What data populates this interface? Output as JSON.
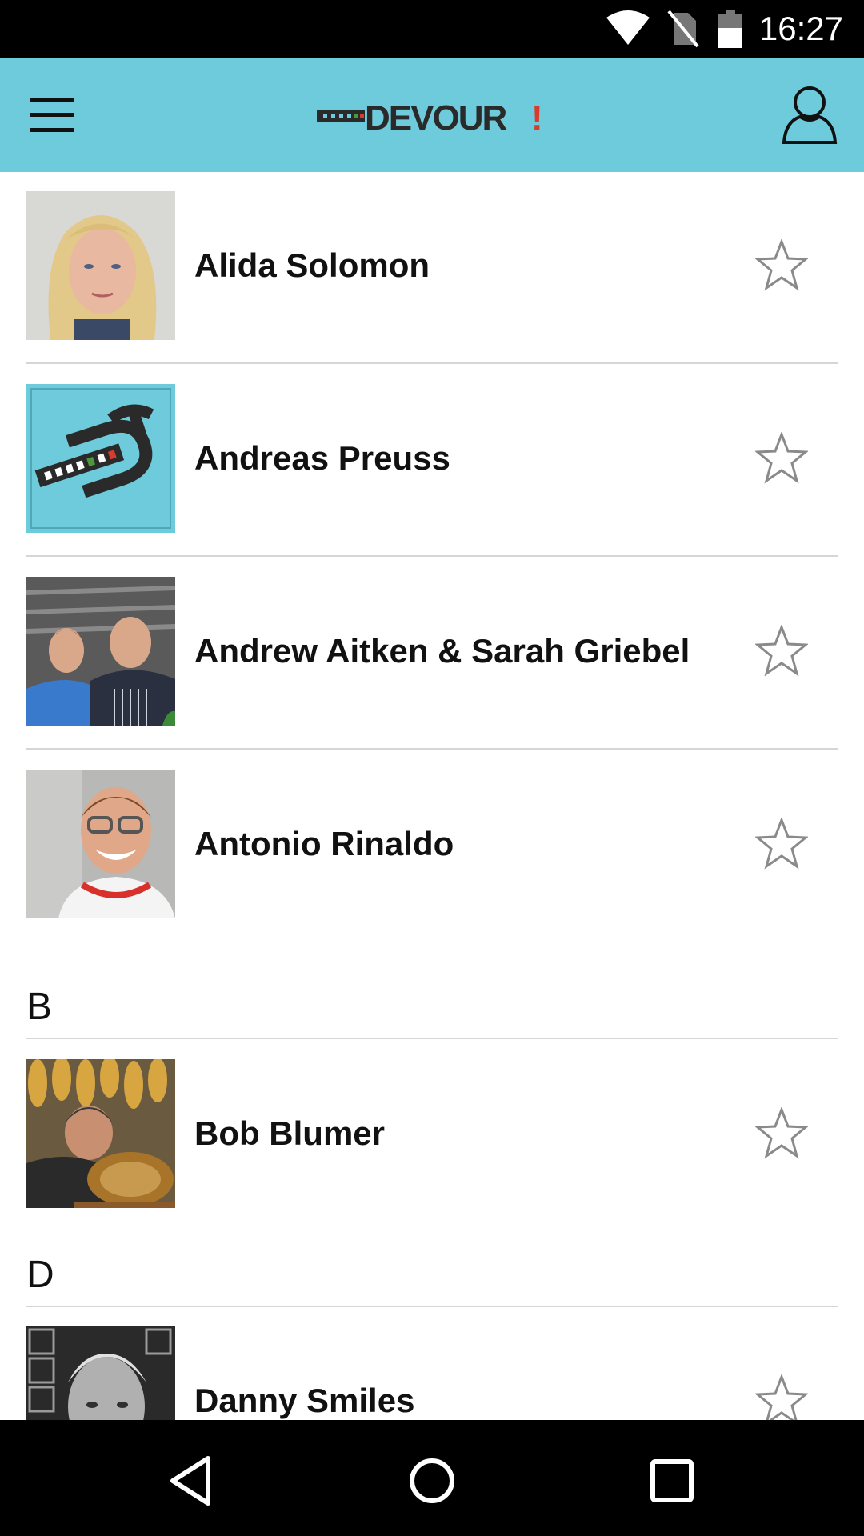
{
  "status_bar": {
    "time": "16:27",
    "icons": [
      "wifi-icon",
      "no-sim-icon",
      "battery-icon"
    ]
  },
  "app_bar": {
    "logo_text": "DEVOUR!",
    "menu_icon": "hamburger-menu-icon",
    "profile_icon": "user-profile-icon",
    "background_color": "#6ecbdc"
  },
  "list": {
    "rows": [
      {
        "name": "Alida Solomon",
        "favorite": false
      },
      {
        "name": "Andreas Preuss",
        "favorite": false
      },
      {
        "name": "Andrew Aitken & Sarah Griebel",
        "favorite": false
      },
      {
        "name": "Antonio Rinaldo",
        "favorite": false
      }
    ],
    "sections": [
      {
        "letter": "B",
        "rows": [
          {
            "name": "Bob Blumer",
            "favorite": false
          }
        ]
      },
      {
        "letter": "D",
        "rows": [
          {
            "name": "Danny Smiles",
            "favorite": false
          }
        ]
      }
    ]
  },
  "nav_bar": {
    "buttons": [
      "back-icon",
      "home-icon",
      "recents-icon"
    ]
  }
}
